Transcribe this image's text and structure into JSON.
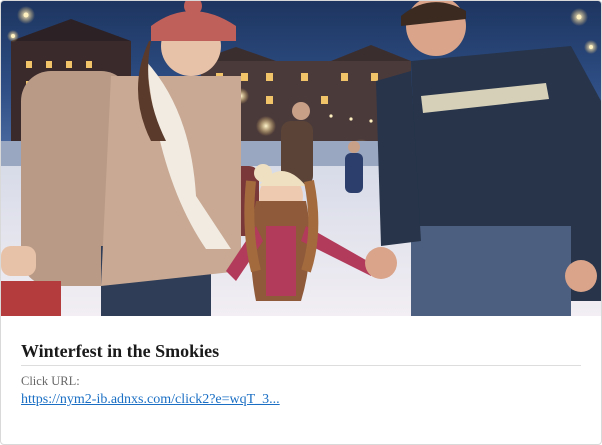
{
  "card": {
    "title": "Winterfest in the Smokies",
    "click_url_label": "Click URL:",
    "click_url_text": "https://nym2-ib.adnxs.com/click2?e=wqT_3..."
  },
  "colors": {
    "title": "#1a1a1a",
    "label": "#666666",
    "link": "#1a6fc4",
    "divider": "#dddddd"
  }
}
